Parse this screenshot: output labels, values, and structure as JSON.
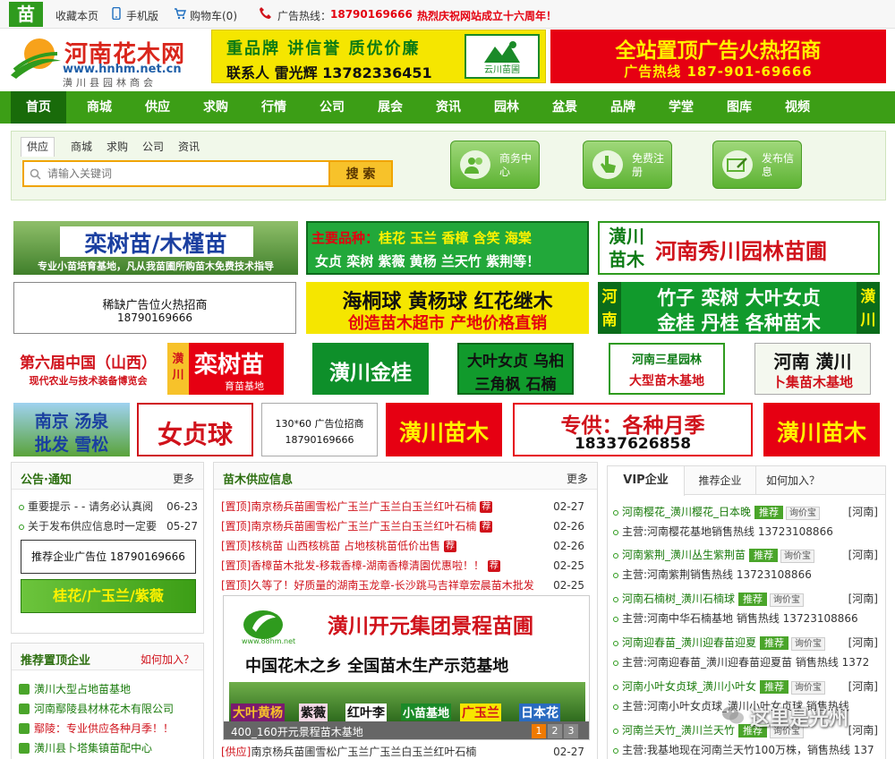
{
  "topbar": {
    "logo_char": "苗",
    "favorite": "收藏本页",
    "mobile": "手机版",
    "cart": "购物车(0)",
    "hotline_label": "广告热线：",
    "hotline_number": "18790169666",
    "celebrate": "热烈庆祝网站成立十六周年！"
  },
  "brand": {
    "title": "河南花木网",
    "url": "www.hnhm.net.cn",
    "sub": "潢川县园林商会"
  },
  "header_ads": {
    "ad1_line1": "重品牌  讲信誉  质优价廉",
    "ad1_line2": "联系人  雷光辉  13782336451",
    "ad1_caption": "云川苗圃",
    "ad2_line1": "全站置顶广告火热招商",
    "ad2_line2": "广告热线   187-901-69666"
  },
  "nav": [
    "首页",
    "商城",
    "供应",
    "求购",
    "行情",
    "公司",
    "展会",
    "资讯",
    "园林",
    "盆景",
    "品牌",
    "学堂",
    "图库",
    "视频"
  ],
  "search": {
    "tabs": [
      "供应",
      "商城",
      "求购",
      "公司",
      "资讯"
    ],
    "placeholder": "请输入关键词",
    "button": "搜 索"
  },
  "portal_buttons": [
    {
      "label": "商务中心"
    },
    {
      "label": "免费注册"
    },
    {
      "label": "发布信息"
    }
  ],
  "ads": {
    "a1_title": "栾树苗/木槿苗",
    "a1_sub": "专业小苗培育基地，凡从我苗圃所购苗木免费技术指导",
    "a2_line1_prefix": "主要品种：",
    "a2_line1": "桂花 玉兰 香樟 含笑 海棠",
    "a2_line2": "女贞 栾树 紫薇 黄杨 兰天竹 紫荆等！",
    "a3_left": "潢川苗木",
    "a3_main": "河南秀川园林苗圃",
    "a4_line1": "稀缺广告位火热招商",
    "a4_line2": "18790169666",
    "a5_line1": "海桐球 黄杨球 红花继木",
    "a5_line2": "创造苗木超市 产地价格直销",
    "a6_side_l": "河南",
    "a6_side_r": "潢川",
    "a6_line1": "竹子  栾树 大叶女贞",
    "a6_line2": "金桂 丹桂  各种苗木",
    "b1_line1": "第六届中国（山西）",
    "b1_line2": "现代农业与技术装备博览会",
    "b2_side": "潢川",
    "b2_main": "栾树苗",
    "b2_sub": "育苗基地",
    "b3": "潢川金桂",
    "b4_line1": "大叶女贞 乌桕",
    "b4_line2": "三角枫 石楠",
    "b5_line1": "河南三星园林",
    "b5_line2": "大型苗木基地",
    "b6_line1": "河南 潢川",
    "b6_line2": "卜集苗木基地",
    "c1_line1": "南京 汤泉",
    "c1_line2": "批发 雪松",
    "c2": "女贞球",
    "c3_line1": "130*60 广告位招商",
    "c3_line2": "18790169666",
    "c4": "潢川苗木",
    "c5_line1": "专供：各种月季",
    "c5_line2": "18337626858",
    "c6": "潢川苗木"
  },
  "notice": {
    "title": "公告·通知",
    "more": "更多",
    "items": [
      {
        "text": "重要提示 - - 请务必认真阅",
        "date": "06-23"
      },
      {
        "text": "关于发布供应信息时一定要",
        "date": "05-27"
      }
    ],
    "ad_box": "推荐企业广告位 18790169666",
    "ad_banner": "桂花/广玉兰/紫薇"
  },
  "top_companies": {
    "title": "推荐置顶企业",
    "join": "如何加入？",
    "items": [
      "潢川大型占地苗基地",
      "河南鄢陵县材林花木有限公司",
      "鄢陵：专业供应各种月季！！",
      "潢川县卜塔集镇苗配中心"
    ]
  },
  "supply": {
    "title": "苗木供应信息",
    "more": "更多",
    "items": [
      {
        "tag": "[置顶]",
        "text": "南京杨兵苗圃雪松广玉兰广玉兰白玉兰红叶石楠",
        "date": "02-27"
      },
      {
        "tag": "[置顶]",
        "text": "南京杨兵苗圃雪松广玉兰广玉兰白玉兰红叶石楠",
        "date": "02-26"
      },
      {
        "tag": "[置顶]",
        "text": "核桃苗 山西核桃苗 占地核桃苗低价出售",
        "date": "02-26"
      },
      {
        "tag": "[置顶]",
        "text": "香樟苗木批发-移栽香樟-湖南香樟清園优惠啦！！",
        "date": "02-25"
      },
      {
        "tag": "[置顶]",
        "text": "久等了！好质量的湖南玉龙章-长沙跳马吉祥章宏晨苗木批发",
        "date": "02-25"
      }
    ],
    "slide_title": "潢川开元集团景程苗圃",
    "slide_url": "www.88hm.net",
    "slide_slogan": "中国花木之乡  全国苗木生产示范基地",
    "slide_labels": [
      "大叶黄杨",
      "紫薇",
      "红叶李",
      "小苗基地",
      "广玉兰",
      "日本花"
    ],
    "slide_caption": "400_160开元景程苗木基地",
    "slide_pages": [
      "1",
      "2",
      "3"
    ],
    "last_item": {
      "tag": "[供应]",
      "text": "南京杨兵苗圃雪松广玉兰广玉兰白玉兰红叶石楠",
      "date": "02-27"
    }
  },
  "vip": {
    "tabs": [
      "VIP企业",
      "推荐企业",
      "如何加入？"
    ],
    "recommend_btn": "推荐",
    "ask_btn": "询价宝",
    "items": [
      {
        "name": "河南樱花_潢川樱花_日本晚",
        "region": "[河南]",
        "main": "主营:河南樱花基地销售热线 13723108866"
      },
      {
        "name": "河南紫荆_潢川丛生紫荆苗",
        "region": "[河南]",
        "main": "主营:河南紫荆销售热线 13723108866"
      },
      {
        "name": "河南石楠树_潢川石楠球",
        "region": "[河南]",
        "main": "主营:河南中华石楠基地 销售热线 13723108866"
      },
      {
        "name": "河南迎春苗_潢川迎春苗迎夏",
        "region": "[河南]",
        "main": "主营:河南迎春苗_潢川迎春苗迎夏苗 销售热线 1372"
      },
      {
        "name": "河南小叶女贞球_潢川小叶女",
        "region": "[河南]",
        "main": "主营:河南小叶女贞球_潢川小叶女贞球 销售热线"
      },
      {
        "name": "河南兰天竹_潢川兰天竹",
        "region": "[河南]",
        "main": "主营:我基地现在河南兰天竹100万株，销售热线 137"
      }
    ]
  },
  "watermark": "这里是光州",
  "colors": {
    "brand_green": "#3c9e16",
    "hot_red": "#e4000f",
    "accent_yellow": "#f7c22a"
  }
}
